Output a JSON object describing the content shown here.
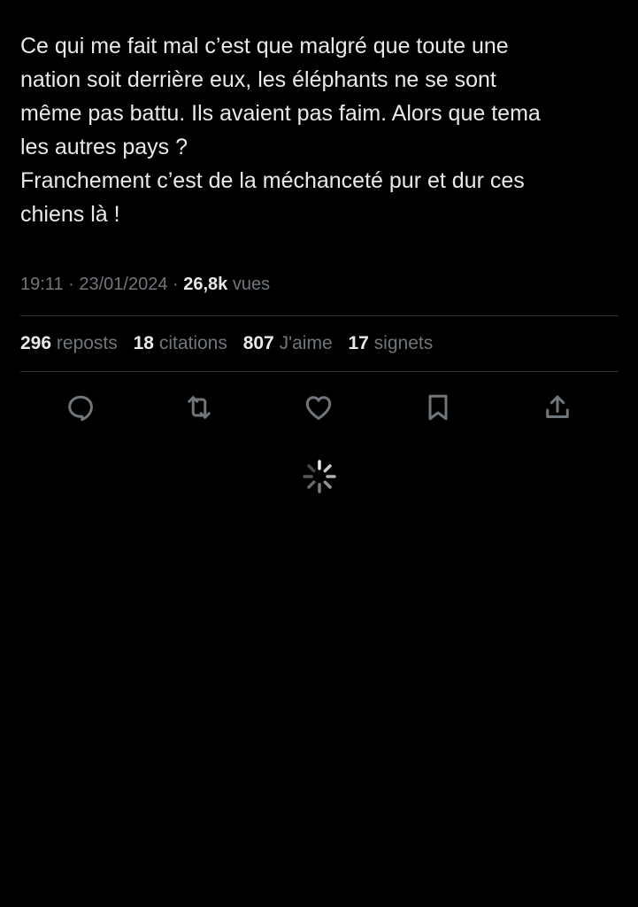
{
  "tweet": {
    "text_lines": [
      "Ce qui me fait mal c’est que malgré que toute une",
      "nation soit derrière eux, les éléphants ne se sont",
      "même pas battu. Ils avaient pas faim. Alors que tema",
      "les autres pays ?",
      "Franchement c’est de la méchanceté pur et dur ces",
      "chiens là !"
    ]
  },
  "meta": {
    "time": "19:11",
    "separator": " · ",
    "date": "23/01/2024",
    "views_count": "26,8k",
    "views_label": "vues"
  },
  "stats": {
    "reposts_count": "296",
    "reposts_label": "reposts",
    "quotes_count": "18",
    "quotes_label": "citations",
    "likes_count": "807",
    "likes_label": "J'aime",
    "bookmarks_count": "17",
    "bookmarks_label": "signets"
  },
  "actions": [
    {
      "icon": "reply-icon"
    },
    {
      "icon": "repost-icon"
    },
    {
      "icon": "like-icon"
    },
    {
      "icon": "bookmark-icon"
    },
    {
      "icon": "share-icon"
    }
  ],
  "colors": {
    "background": "#000000",
    "text_primary": "#e7e9ea",
    "text_secondary": "#71767b",
    "divider": "#2f3336"
  },
  "loading_indicator": {
    "icon": "loading-spinner-icon"
  }
}
